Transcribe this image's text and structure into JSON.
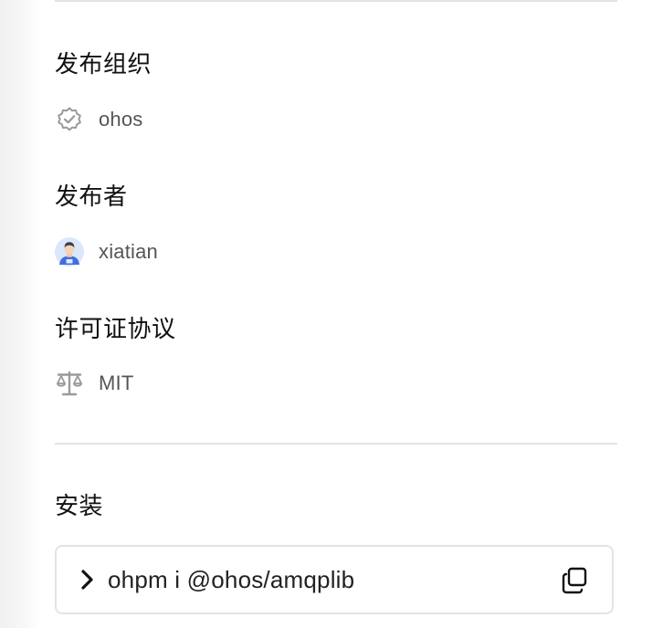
{
  "organization": {
    "title": "发布组织",
    "name": "ohos",
    "icon": "verified-badge-icon"
  },
  "publisher": {
    "title": "发布者",
    "name": "xiatian",
    "icon": "user-avatar"
  },
  "license": {
    "title": "许可证协议",
    "name": "MIT",
    "icon": "scale-icon"
  },
  "install": {
    "title": "安装",
    "command": "ohpm i @ohos/amqplib",
    "prompt_icon": "chevron-right-icon",
    "copy_icon": "copy-icon"
  },
  "colors": {
    "text_primary": "#111111",
    "text_secondary": "#555555",
    "divider": "#e3e3e3",
    "icon_gray": "#9a9a9a",
    "avatar_blue": "#3f6fe0"
  }
}
